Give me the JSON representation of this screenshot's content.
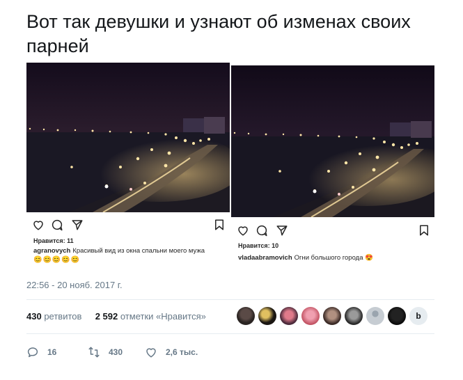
{
  "tweet": {
    "text": "Вот так девушки и узнают об изменах своих парней",
    "timestamp": "22:56 - 20 нояб. 2017 г."
  },
  "posts": [
    {
      "likes": "Нравится: 11",
      "username": "agranovych",
      "caption": "Красивый вид из окна спальни моего мужа",
      "emojis": "😊😊😊😊😊"
    },
    {
      "likes": "Нравится: 10",
      "username": "vladaabramovich",
      "caption": "Огни большого города 😍"
    }
  ],
  "stats": {
    "retweets_count": "430",
    "retweets_label": "ретвитов",
    "likes_count": "2 592",
    "likes_label": "отметки «Нравится»"
  },
  "actions": {
    "replies": "16",
    "retweets": "430",
    "likes": "2,6 тыс."
  },
  "colors": {
    "muted": "#657786",
    "divider": "#e6ecf0",
    "night_sky": "#17101e",
    "city_lights": "#ffd98a"
  },
  "icons": [
    "heart-icon",
    "comment-icon",
    "share-icon",
    "bookmark-icon",
    "reply-icon",
    "retweet-icon",
    "like-icon"
  ]
}
